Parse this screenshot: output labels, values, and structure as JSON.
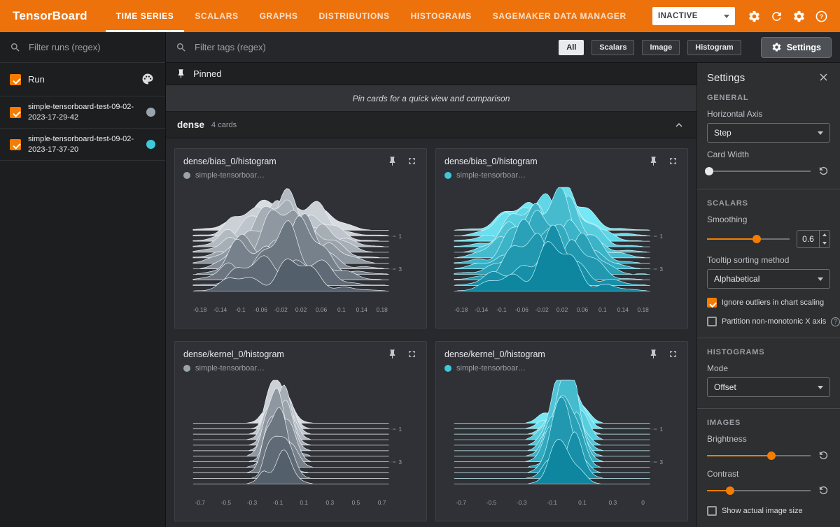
{
  "header": {
    "logo": "TensorBoard",
    "tabs": [
      {
        "label": "TIME SERIES",
        "active": true
      },
      {
        "label": "SCALARS",
        "active": false
      },
      {
        "label": "GRAPHS",
        "active": false
      },
      {
        "label": "DISTRIBUTIONS",
        "active": false
      },
      {
        "label": "HISTOGRAMS",
        "active": false
      },
      {
        "label": "SAGEMAKER DATA MANAGER",
        "active": false
      }
    ],
    "status_dropdown_value": "INACTIVE",
    "icons": [
      "reload-settings-icon",
      "refresh-icon",
      "settings-gear-icon",
      "help-icon"
    ],
    "accent_color": "#ee720c"
  },
  "sidebar": {
    "filter_placeholder": "Filter runs (regex)",
    "select_all": {
      "label": "Run",
      "checked": true
    },
    "runs": [
      {
        "label": "simple-tensorboard-test-09-02-2023-17-29-42",
        "checked": true,
        "color": "#9aa4ad"
      },
      {
        "label": "simple-tensorboard-test-09-02-2023-17-37-20",
        "checked": true,
        "color": "#3ec9da"
      }
    ]
  },
  "toolbar": {
    "filter_placeholder": "Filter tags (regex)",
    "chips": [
      {
        "label": "All",
        "active": true
      },
      {
        "label": "Scalars",
        "active": false
      },
      {
        "label": "Image",
        "active": false
      },
      {
        "label": "Histogram",
        "active": false
      }
    ],
    "settings_button_label": "Settings"
  },
  "pinned": {
    "title": "Pinned",
    "hint": "Pin cards for a quick view and comparison"
  },
  "tag_group": {
    "name": "dense",
    "count": "4 cards"
  },
  "chart_data": [
    {
      "type": "histogram",
      "title": "dense/bias_0/histogram",
      "legend": "simple-tensorboar…",
      "run_color": "#9aa4ad",
      "palette": {
        "top": "#d7dce1",
        "bottom": "#535f6b",
        "stroke": "#eef1f4"
      },
      "x_ticks": [
        "-0.18",
        "-0.14",
        "-0.1",
        "-0.06",
        "-0.02",
        "0.02",
        "0.06",
        "0.1",
        "0.14",
        "0.18"
      ],
      "step_ticks": [
        "1",
        "3"
      ],
      "step_tick_pos": [
        0.45,
        0.78
      ],
      "shape": {
        "center": 0.48,
        "sigma": 0.17,
        "ridges": 12,
        "amp": 56,
        "seed": 7
      }
    },
    {
      "type": "histogram",
      "title": "dense/bias_0/histogram",
      "legend": "simple-tensorboar…",
      "run_color": "#3ec9da",
      "palette": {
        "top": "#74e8f5",
        "bottom": "#0e86a0",
        "stroke": "#c9f6fb"
      },
      "x_ticks": [
        "-0.18",
        "-0.14",
        "-0.1",
        "-0.06",
        "-0.02",
        "0.02",
        "0.06",
        "0.1",
        "0.14",
        "0.18"
      ],
      "step_ticks": [
        "1",
        "3"
      ],
      "step_tick_pos": [
        0.45,
        0.78
      ],
      "shape": {
        "center": 0.5,
        "sigma": 0.165,
        "ridges": 12,
        "amp": 58,
        "seed": 11
      }
    },
    {
      "type": "histogram",
      "title": "dense/kernel_0/histogram",
      "legend": "simple-tensorboar…",
      "run_color": "#9aa4ad",
      "palette": {
        "top": "#d7dce1",
        "bottom": "#535f6b",
        "stroke": "#eef1f4"
      },
      "x_ticks": [
        "-0.7",
        "-0.5",
        "-0.3",
        "-0.1",
        "0.1",
        "0.3",
        "0.5",
        "0.7"
      ],
      "step_ticks": [
        "1",
        "3"
      ],
      "step_tick_pos": [
        0.45,
        0.78
      ],
      "shape": {
        "center": 0.44,
        "sigma": 0.055,
        "ridges": 12,
        "amp": 76,
        "seed": 23
      }
    },
    {
      "type": "histogram",
      "title": "dense/kernel_0/histogram",
      "legend": "simple-tensorboar…",
      "run_color": "#3ec9da",
      "palette": {
        "top": "#74e8f5",
        "bottom": "#0e86a0",
        "stroke": "#c9f6fb"
      },
      "x_ticks": [
        "-0.7",
        "-0.5",
        "-0.3",
        "-0.1",
        "0.1",
        "0.3",
        "0"
      ],
      "step_ticks": [
        "1",
        "3"
      ],
      "step_tick_pos": [
        0.45,
        0.78
      ],
      "shape": {
        "center": 0.58,
        "sigma": 0.06,
        "ridges": 12,
        "amp": 78,
        "seed": 31
      }
    }
  ],
  "settings_panel": {
    "title": "Settings",
    "general": {
      "heading": "GENERAL",
      "horizontal_axis_label": "Horizontal Axis",
      "horizontal_axis_value": "Step",
      "card_width_label": "Card Width",
      "card_width_pos": 0.02
    },
    "scalars": {
      "heading": "SCALARS",
      "smoothing_label": "Smoothing",
      "smoothing_value": "0.6",
      "smoothing_pos": 0.6,
      "tooltip_sort_label": "Tooltip sorting method",
      "tooltip_sort_value": "Alphabetical",
      "ignore_outliers": {
        "label": "Ignore outliers in chart scaling",
        "checked": true
      },
      "partition_x": {
        "label": "Partition non-monotonic X axis",
        "checked": false
      }
    },
    "histograms": {
      "heading": "HISTOGRAMS",
      "mode_label": "Mode",
      "mode_value": "Offset"
    },
    "images": {
      "heading": "IMAGES",
      "brightness_label": "Brightness",
      "brightness_pos": 0.62,
      "contrast_label": "Contrast",
      "contrast_pos": 0.22,
      "show_actual_size": {
        "label": "Show actual image size",
        "checked": false
      }
    }
  }
}
